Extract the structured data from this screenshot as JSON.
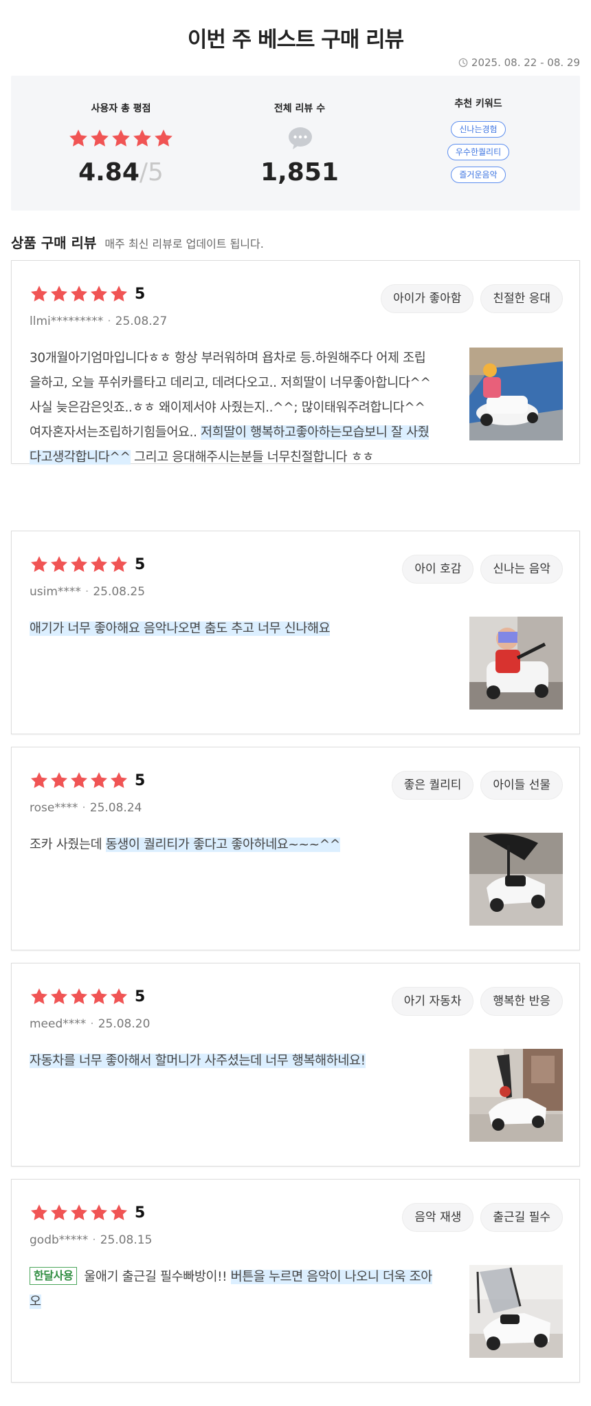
{
  "header": {
    "title": "이번 주 베스트 구매 리뷰",
    "period": "2025. 08. 22 - 08. 29"
  },
  "summary": {
    "rating_label": "사용자 총 평점",
    "rating_value": "4.84",
    "rating_slash": "/",
    "rating_max": "5",
    "count_label": "전체 리뷰 수",
    "count_value": "1,851",
    "keywords_label": "추천 키워드",
    "keywords": [
      "신나는경험",
      "우수한퀄리티",
      "즐거운음악"
    ]
  },
  "section": {
    "title": "상품 구매 리뷰",
    "subtitle": "매주 최신 리뷰로 업데이트 됩니다."
  },
  "colors": {
    "star": "#f05454",
    "highlight": "#dcefff",
    "keyword": "#3b73e0",
    "badge": "#2f8d40"
  },
  "icons": [
    "clock-icon",
    "star-icon",
    "chat-icon"
  ],
  "reviews": [
    {
      "rating": "5",
      "user": "llmi*********",
      "date": "25.08.27",
      "tags": [
        "아이가 좋아함",
        "친절한 응대"
      ],
      "badge": "",
      "text_plain": "30개월아기엄마입니다ㅎㅎ 항상 부러워하며 욥차로 등.하원해주다 어제 조립을하고, 오늘 푸쉬카를타고 데리고, 데려다오고.. 저희딸이 너무좋아합니다^^ 사실 늦은감은잇죠..ㅎㅎ 왜이제서야 사줬는지..^^; 많이태워주려합니다^^ 여자혼자서는조립하기힘들어요.. ",
      "text_highlight": "저희딸이 행복하고좋아하는모습보니 잘 사줬다고생각합니다^^",
      "text_after": " 그리고 응대해주시는분들 너무친절합니다 ㅎㅎ",
      "photo": "photo-girl-car"
    },
    {
      "rating": "5",
      "user": "usim****",
      "date": "25.08.25",
      "tags": [
        "아이 호감",
        "신나는 음악"
      ],
      "badge": "",
      "text_plain": "",
      "text_highlight": "애기가 너무 좋아해요 음악나오면 춤도 추고 너무 신나해요",
      "text_after": "",
      "photo": "photo-baby-car"
    },
    {
      "rating": "5",
      "user": "rose****",
      "date": "25.08.24",
      "tags": [
        "좋은 퀄리티",
        "아이들 선물"
      ],
      "badge": "",
      "text_plain": "조카 사줬는데 ",
      "text_highlight": "동생이 퀄리티가 좋다고 좋아하네요~~~^^",
      "text_after": "",
      "photo": "photo-car-floor"
    },
    {
      "rating": "5",
      "user": "meed****",
      "date": "25.08.20",
      "tags": [
        "아기 자동차",
        "행복한 반응"
      ],
      "badge": "",
      "text_plain": "",
      "text_highlight": "자동차를 너무 좋아해서 할머니가 사주셨는데 너무 행복해하네요!",
      "text_after": "",
      "photo": "photo-car-lobby"
    },
    {
      "rating": "5",
      "user": "godb*****",
      "date": "25.08.15",
      "tags": [
        "음악 재생",
        "출근길 필수"
      ],
      "badge": "한달사용",
      "text_plain": "울애기 출근길 필수빠방이!! ",
      "text_highlight": "버튼을 누르면 음악이 나오니 더욱 조아오",
      "text_after": "",
      "photo": "photo-car-canopy"
    }
  ]
}
